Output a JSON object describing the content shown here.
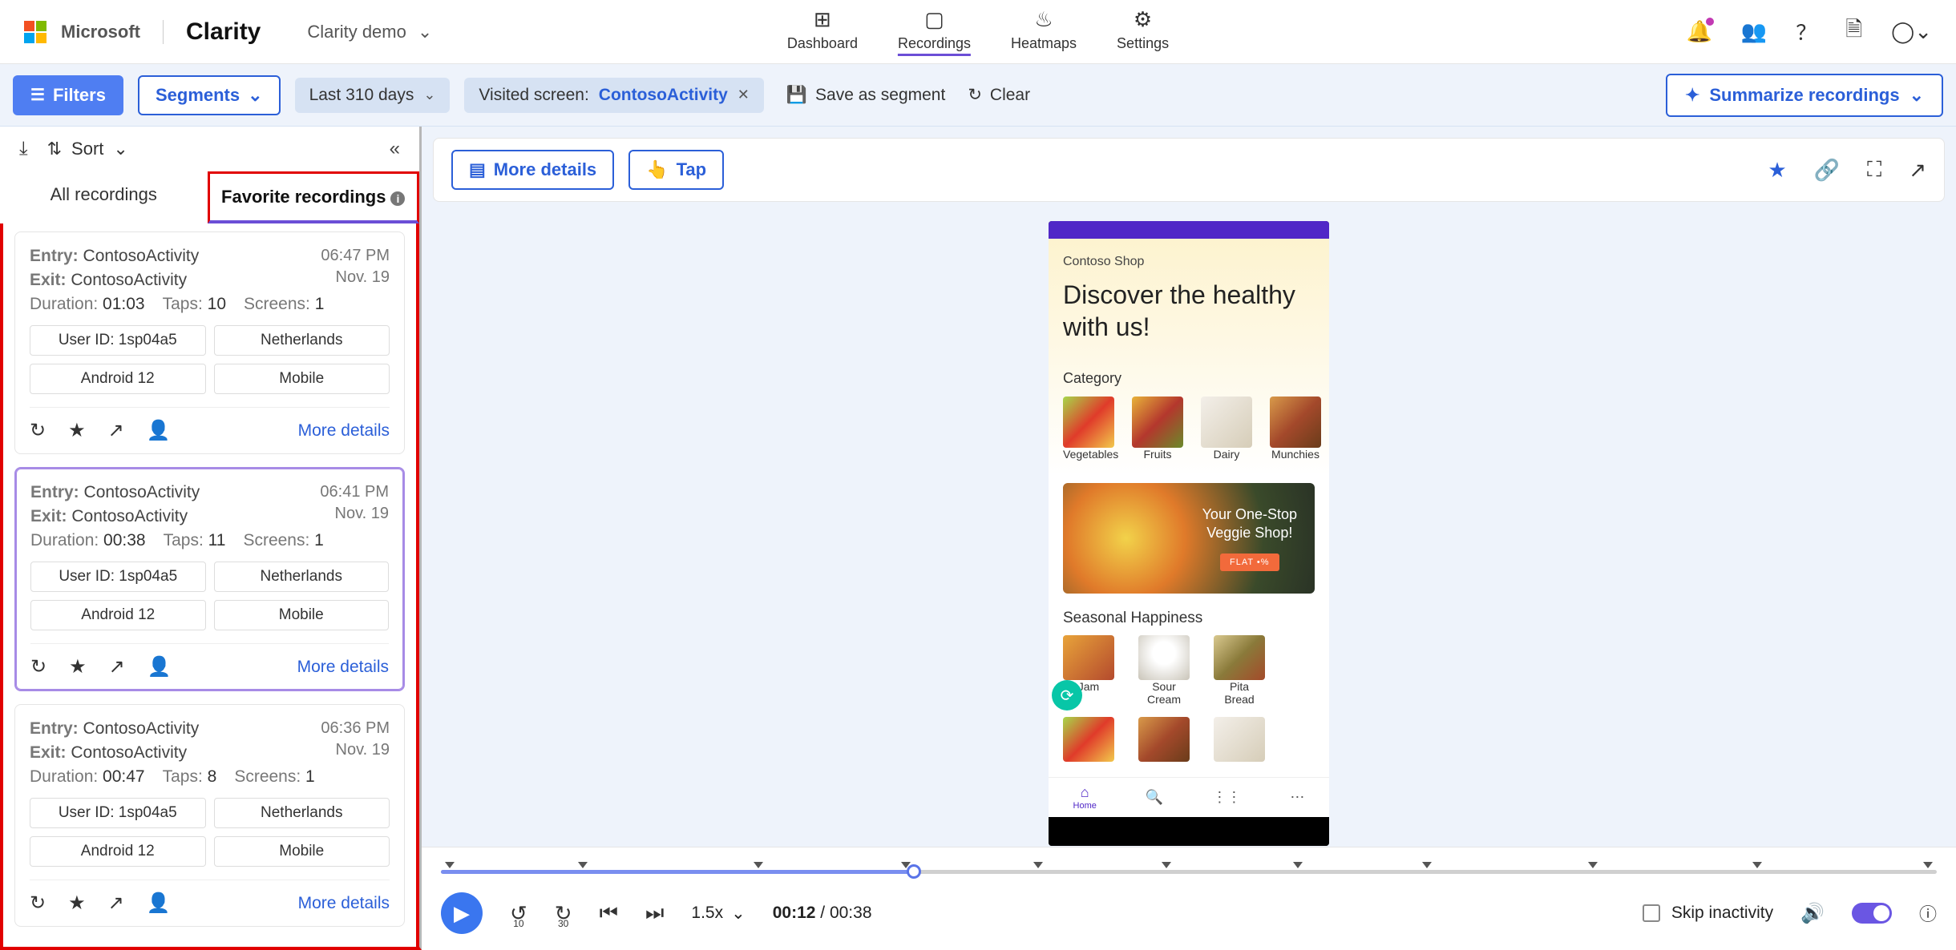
{
  "header": {
    "microsoft": "Microsoft",
    "clarity": "Clarity",
    "demo_label": "Clarity demo",
    "nav": {
      "dashboard": "Dashboard",
      "recordings": "Recordings",
      "heatmaps": "Heatmaps",
      "settings": "Settings"
    }
  },
  "filterbar": {
    "filters": "Filters",
    "segments": "Segments",
    "date_chip": "Last 310 days",
    "screen_chip_prefix": "Visited screen: ",
    "screen_chip_value": "ContosoActivity",
    "save_segment": "Save as segment",
    "clear": "Clear",
    "summarize": "Summarize recordings"
  },
  "sidebar": {
    "sort": "Sort",
    "tabs": {
      "all": "All recordings",
      "favorite": "Favorite recordings"
    },
    "labels": {
      "entry": "Entry:",
      "exit": "Exit:",
      "duration": "Duration:",
      "taps": "Taps:",
      "screens": "Screens:",
      "more_details": "More details"
    },
    "cards": [
      {
        "entry": "ContosoActivity",
        "exit": "ContosoActivity",
        "time": "06:47 PM",
        "date": "Nov. 19",
        "duration": "01:03",
        "taps": "10",
        "screens": "1",
        "tags": [
          "User ID: 1sp04a5",
          "Netherlands",
          "Android 12",
          "Mobile"
        ],
        "selected": false
      },
      {
        "entry": "ContosoActivity",
        "exit": "ContosoActivity",
        "time": "06:41 PM",
        "date": "Nov. 19",
        "duration": "00:38",
        "taps": "11",
        "screens": "1",
        "tags": [
          "User ID: 1sp04a5",
          "Netherlands",
          "Android 12",
          "Mobile"
        ],
        "selected": true
      },
      {
        "entry": "ContosoActivity",
        "exit": "ContosoActivity",
        "time": "06:36 PM",
        "date": "Nov. 19",
        "duration": "00:47",
        "taps": "8",
        "screens": "1",
        "tags": [
          "User ID: 1sp04a5",
          "Netherlands",
          "Android 12",
          "Mobile"
        ],
        "selected": false
      }
    ]
  },
  "main_toolbar": {
    "more_details": "More details",
    "tap": "Tap"
  },
  "phone": {
    "shop": "Contoso Shop",
    "hero": "Discover the healthy with us!",
    "category_title": "Category",
    "categories": [
      "Vegetables",
      "Fruits",
      "Dairy",
      "Munchies"
    ],
    "banner_line1": "Your One-Stop",
    "banner_line2": "Veggie Shop!",
    "banner_cta": "FLAT •%",
    "seasonal_title": "Seasonal Happiness",
    "products": [
      "Jam",
      "Sour Cream",
      "Pita Bread"
    ],
    "bottom_nav_home": "Home"
  },
  "player": {
    "speed": "1.5x",
    "current": "00:12",
    "total": "00:38",
    "skip_inactivity": "Skip inactivity",
    "back_secs": "10",
    "fwd_secs": "30"
  }
}
